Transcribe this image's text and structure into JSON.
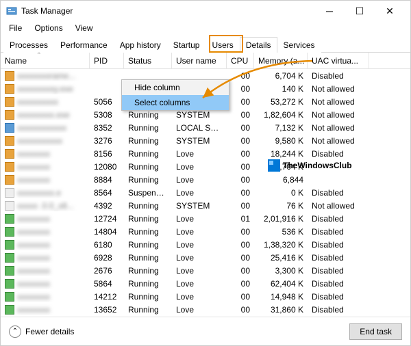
{
  "window": {
    "title": "Task Manager"
  },
  "menu": {
    "file": "File",
    "options": "Options",
    "view": "View"
  },
  "tabs": {
    "processes": "Processes",
    "performance": "Performance",
    "apphistory": "App history",
    "startup": "Startup",
    "users": "Users",
    "details": "Details",
    "services": "Services"
  },
  "columns": {
    "name": "Name",
    "pid": "PID",
    "status": "Status",
    "user": "User name",
    "cpu": "CPU",
    "mem": "Memory (a...",
    "uac": "UAC virtua..."
  },
  "context_menu": {
    "hide": "Hide column",
    "select": "Select columns"
  },
  "rows": [
    {
      "ico": "o",
      "name": "xxxxxxxxrame...",
      "pid": "",
      "status": "",
      "user": "",
      "cpu": "00",
      "mem": "6,704 K",
      "uac": "Disabled"
    },
    {
      "ico": "o",
      "name": "xxxxxxxxxy.exe",
      "pid": "",
      "status": "",
      "user": "",
      "cpu": "00",
      "mem": "140 K",
      "uac": "Not allowed"
    },
    {
      "ico": "o",
      "name": "xxxxxxxxxx",
      "pid": "5056",
      "status": "Running",
      "user": "SYSTEM",
      "cpu": "00",
      "mem": "53,272 K",
      "uac": "Not allowed"
    },
    {
      "ico": "o",
      "name": "xxxxxxxxx.exe",
      "pid": "5308",
      "status": "Running",
      "user": "SYSTEM",
      "cpu": "00",
      "mem": "1,82,604 K",
      "uac": "Not allowed"
    },
    {
      "ico": "b",
      "name": "xxxxxxxxxxxx",
      "pid": "8352",
      "status": "Running",
      "user": "LOCAL SE...",
      "cpu": "00",
      "mem": "7,132 K",
      "uac": "Not allowed"
    },
    {
      "ico": "o",
      "name": "xxxxxxxxxxx",
      "pid": "3276",
      "status": "Running",
      "user": "SYSTEM",
      "cpu": "00",
      "mem": "9,580 K",
      "uac": "Not allowed"
    },
    {
      "ico": "o",
      "name": "xxxxxxxx",
      "pid": "8156",
      "status": "Running",
      "user": "Love",
      "cpu": "00",
      "mem": "18,244 K",
      "uac": "Disabled"
    },
    {
      "ico": "o",
      "name": "xxxxxxxx",
      "pid": "12080",
      "status": "Running",
      "user": "Love",
      "cpu": "00",
      "mem": "6,704 K",
      "uac": ""
    },
    {
      "ico": "o",
      "name": "xxxxxxxx",
      "pid": "8884",
      "status": "Running",
      "user": "Love",
      "cpu": "00",
      "mem": "6,844",
      "uac": ""
    },
    {
      "ico": "w",
      "name": "xxxxxxxxx.e",
      "pid": "8564",
      "status": "Suspended",
      "user": "Love",
      "cpu": "00",
      "mem": "0 K",
      "uac": "Disabled"
    },
    {
      "ico": "w",
      "name": "xxxxx .0.0_x8...",
      "pid": "4392",
      "status": "Running",
      "user": "SYSTEM",
      "cpu": "00",
      "mem": "76 K",
      "uac": "Not allowed"
    },
    {
      "ico": "g",
      "name": "xxxxxxxx",
      "pid": "12724",
      "status": "Running",
      "user": "Love",
      "cpu": "01",
      "mem": "2,01,916 K",
      "uac": "Disabled"
    },
    {
      "ico": "g",
      "name": "xxxxxxxx",
      "pid": "14804",
      "status": "Running",
      "user": "Love",
      "cpu": "00",
      "mem": "536 K",
      "uac": "Disabled"
    },
    {
      "ico": "g",
      "name": "xxxxxxxx",
      "pid": "6180",
      "status": "Running",
      "user": "Love",
      "cpu": "00",
      "mem": "1,38,320 K",
      "uac": "Disabled"
    },
    {
      "ico": "g",
      "name": "xxxxxxxx",
      "pid": "6928",
      "status": "Running",
      "user": "Love",
      "cpu": "00",
      "mem": "25,416 K",
      "uac": "Disabled"
    },
    {
      "ico": "g",
      "name": "xxxxxxxx",
      "pid": "2676",
      "status": "Running",
      "user": "Love",
      "cpu": "00",
      "mem": "3,300 K",
      "uac": "Disabled"
    },
    {
      "ico": "g",
      "name": "xxxxxxxx",
      "pid": "5864",
      "status": "Running",
      "user": "Love",
      "cpu": "00",
      "mem": "62,404 K",
      "uac": "Disabled"
    },
    {
      "ico": "g",
      "name": "xxxxxxxx",
      "pid": "14212",
      "status": "Running",
      "user": "Love",
      "cpu": "00",
      "mem": "14,948 K",
      "uac": "Disabled"
    },
    {
      "ico": "g",
      "name": "xxxxxxxx",
      "pid": "13652",
      "status": "Running",
      "user": "Love",
      "cpu": "00",
      "mem": "31,860 K",
      "uac": "Disabled"
    }
  ],
  "footer": {
    "fewer": "Fewer details",
    "endtask": "End task"
  },
  "watermark": "TheWindowsClub"
}
